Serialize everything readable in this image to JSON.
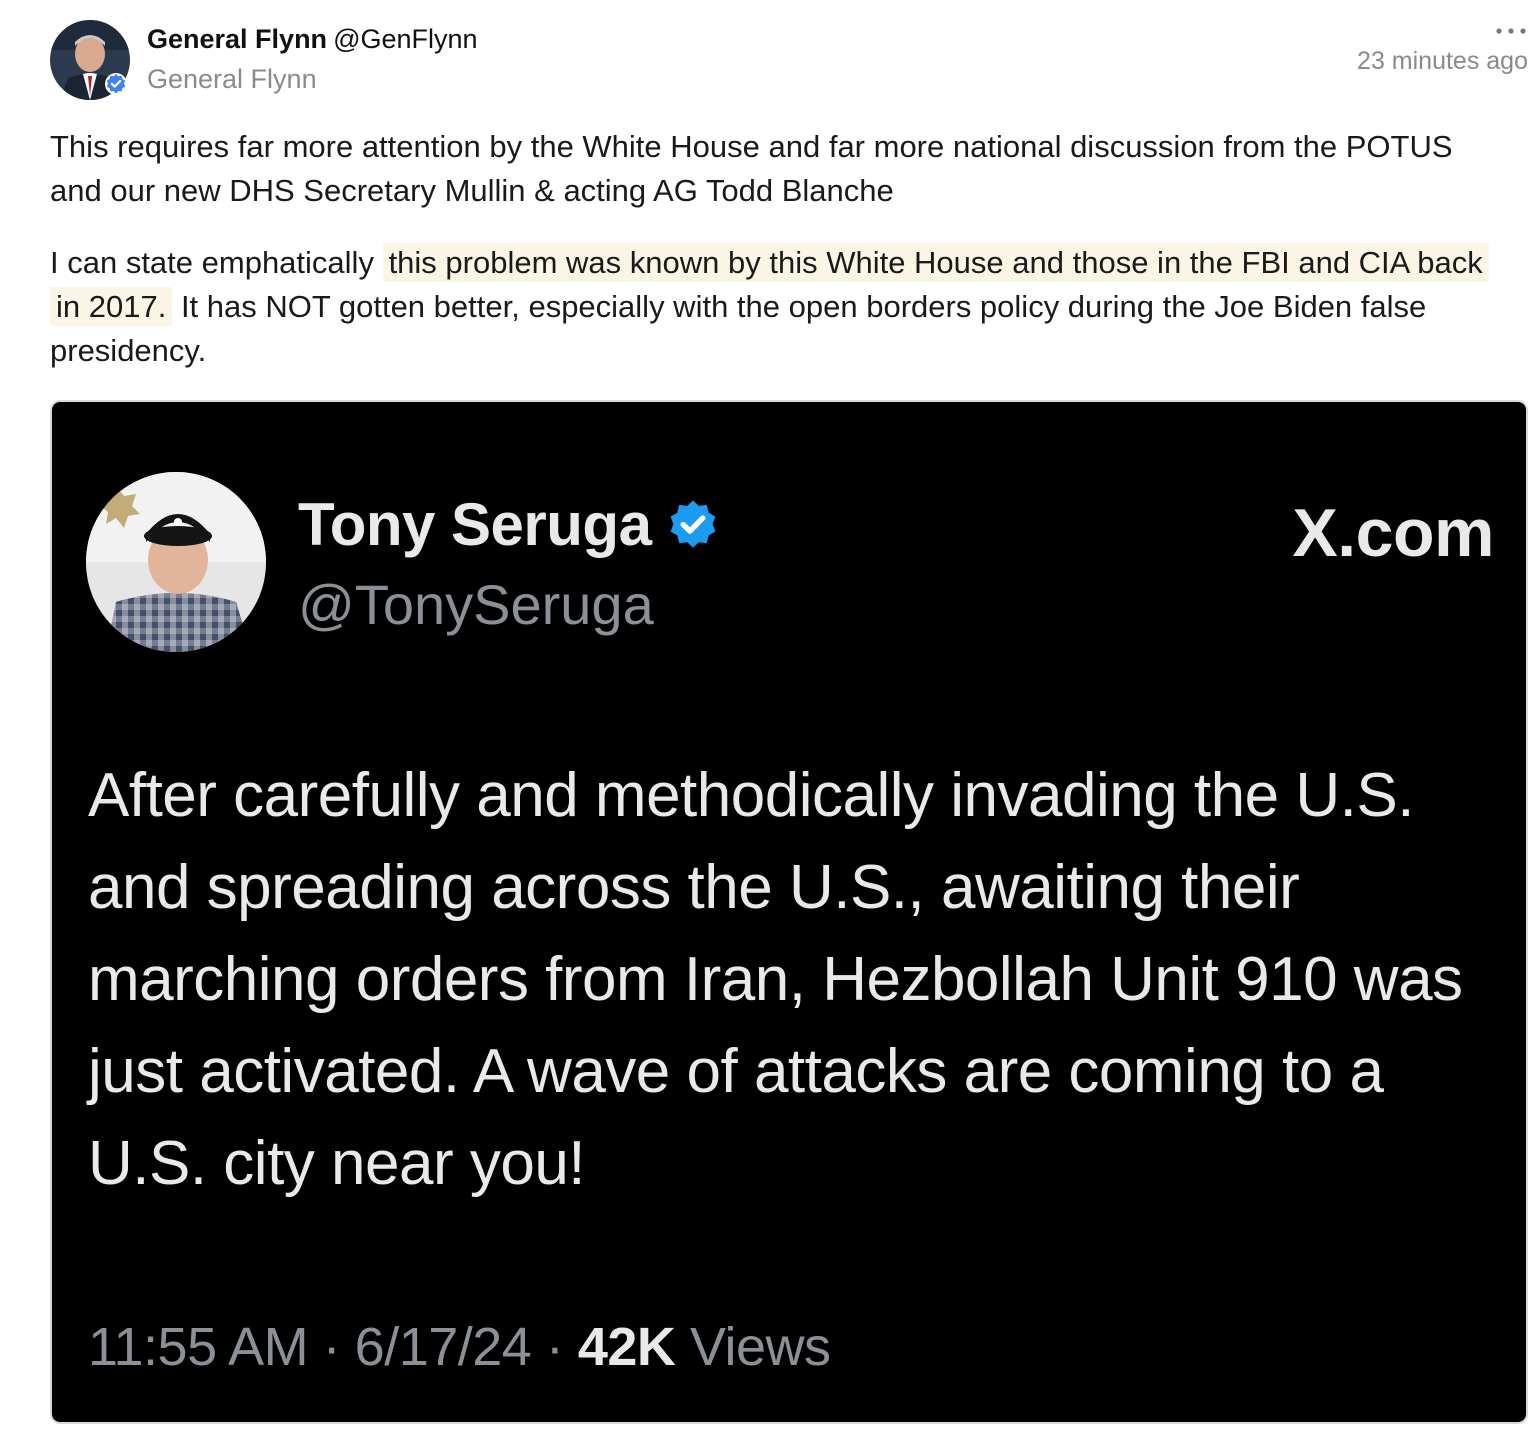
{
  "post": {
    "author_name": "General Flynn",
    "author_handle": "@GenFlynn",
    "author_subtitle": "General Flynn",
    "timestamp": "23 minutes ago",
    "paragraph1": "This requires far more attention by the White House and far more national discussion from the POTUS and our new DHS Secretary Mullin & acting AG Todd Blanche",
    "paragraph2_prefix": "I can state emphatically ",
    "paragraph2_highlight": "this problem was known by this White House and those in the FBI and CIA back in 2017.",
    "paragraph2_suffix": " It has NOT gotten better, especially with the open borders policy during the Joe Biden false presidency.",
    "highlight_color": "#fbf5e6"
  },
  "embed": {
    "name": "Tony Seruga",
    "handle": "@TonySeruga",
    "brand": "X.com",
    "text": "After carefully and methodically invading the U.S. and spreading across the U.S., awaiting their marching orders from Iran, Hezbollah Unit 910 was just activated. A wave of attacks are coming to a U.S. city near you!",
    "time": "11:55 AM",
    "date": "6/17/24",
    "views_count": "42K",
    "views_label": "Views",
    "separator": "·",
    "verified_color": "#1d9bf0",
    "background": "#000000"
  },
  "icons": {
    "more": "more-horizontal-icon",
    "verified": "verified-badge-icon"
  }
}
